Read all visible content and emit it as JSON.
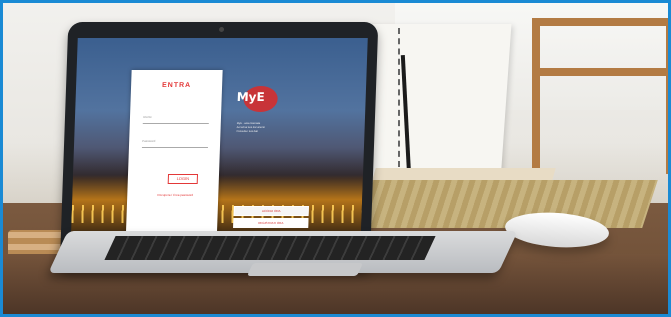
{
  "screen": {
    "login": {
      "heading": "ENTRA",
      "user_placeholder": "Utente",
      "password_placeholder": "Password",
      "login_label": "LOGIN",
      "forgot_label": "Recupera / Crea password"
    },
    "brand": {
      "logo_text": "MyE"
    },
    "info": {
      "lines": [
        "MyE - area riservata",
        "Accedi ai tuoi documenti",
        "Consulta i tuoi dati"
      ]
    },
    "buttons": {
      "first": "ACCEDI ORA",
      "second": "REGISTRATI ORA"
    }
  }
}
